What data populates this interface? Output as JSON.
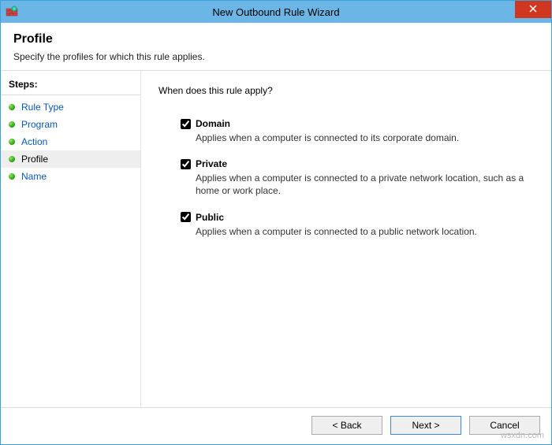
{
  "window": {
    "title": "New Outbound Rule Wizard"
  },
  "header": {
    "title": "Profile",
    "subtitle": "Specify the profiles for which this rule applies."
  },
  "steps": {
    "header": "Steps:",
    "items": [
      {
        "label": "Rule Type",
        "current": false
      },
      {
        "label": "Program",
        "current": false
      },
      {
        "label": "Action",
        "current": false
      },
      {
        "label": "Profile",
        "current": true
      },
      {
        "label": "Name",
        "current": false
      }
    ]
  },
  "content": {
    "prompt": "When does this rule apply?",
    "options": [
      {
        "label": "Domain",
        "desc": "Applies when a computer is connected to its corporate domain.",
        "checked": true
      },
      {
        "label": "Private",
        "desc": "Applies when a computer is connected to a private network location, such as a home or work place.",
        "checked": true
      },
      {
        "label": "Public",
        "desc": "Applies when a computer is connected to a public network location.",
        "checked": true
      }
    ]
  },
  "footer": {
    "back": "< Back",
    "next": "Next >",
    "cancel": "Cancel"
  },
  "watermark": "wsxdn.com"
}
